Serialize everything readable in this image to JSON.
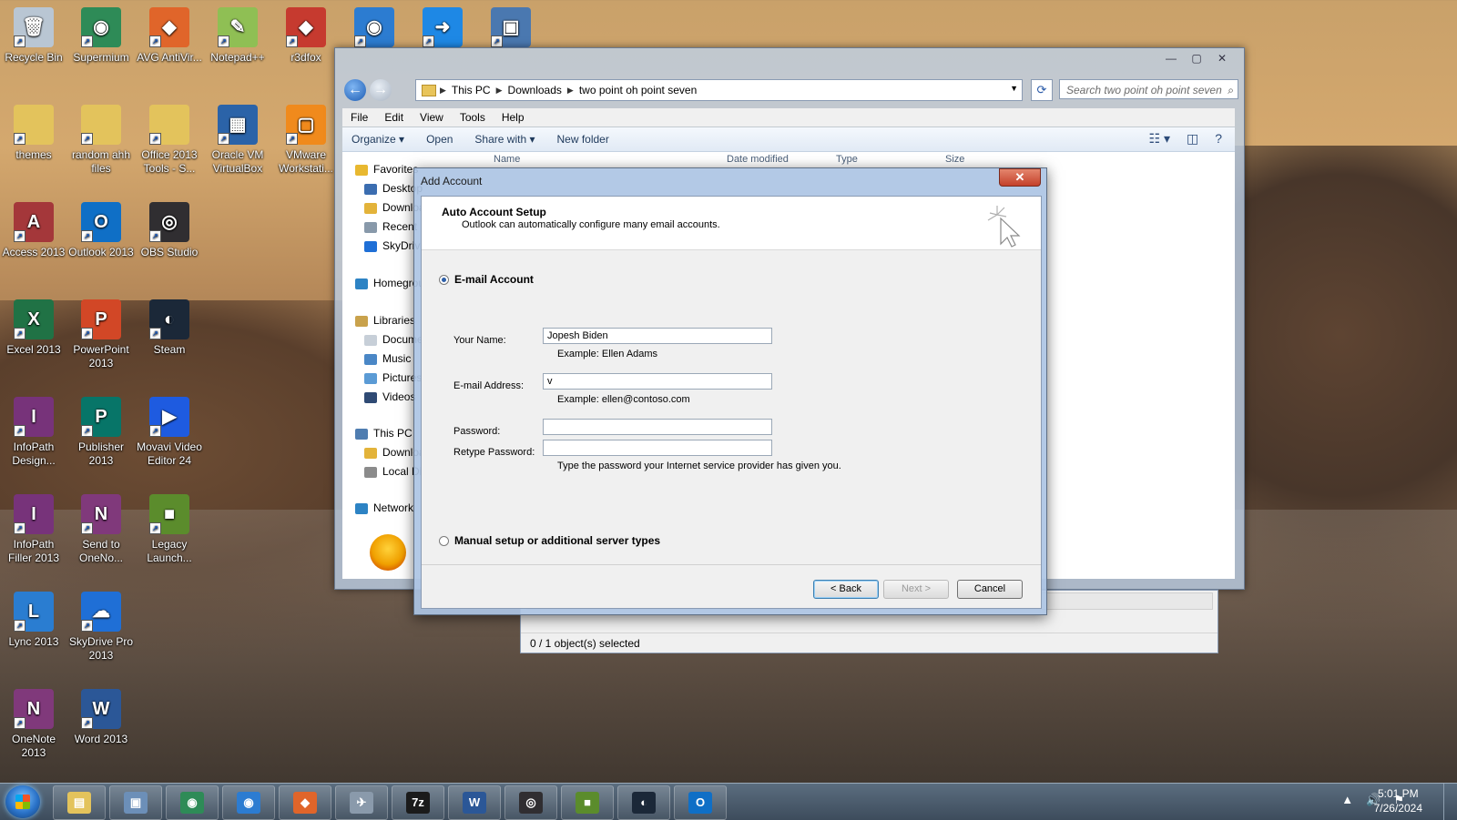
{
  "desktop": {
    "icons": [
      {
        "label": "Recycle Bin",
        "color": "#b9c6d3",
        "glyph": "🗑"
      },
      {
        "label": "Supermium",
        "color": "#2e8b57",
        "glyph": "◉"
      },
      {
        "label": "AVG AntiVir...",
        "color": "#e0652a",
        "glyph": "◆"
      },
      {
        "label": "Notepad++",
        "color": "#8fbf54",
        "glyph": "✎"
      },
      {
        "label": "r3dfox",
        "color": "#c63a2f",
        "glyph": "◆"
      },
      {
        "label": "",
        "color": "#2c7cd1",
        "glyph": "◉"
      },
      {
        "label": "",
        "color": "#1e88e5",
        "glyph": "➜"
      },
      {
        "label": "",
        "color": "#4a78b0",
        "glyph": "▣"
      },
      {
        "label": "themes",
        "color": "#e3c35c",
        "glyph": ""
      },
      {
        "label": "random ahh files",
        "color": "#e3c35c",
        "glyph": ""
      },
      {
        "label": "Office 2013 Tools - S...",
        "color": "#e3c35c",
        "glyph": ""
      },
      {
        "label": "Oracle VM VirtualBox",
        "color": "#2b63a8",
        "glyph": "▦"
      },
      {
        "label": "VMware Workstati...",
        "color": "#f08a1c",
        "glyph": "▢"
      },
      {
        "label": "Access 2013",
        "color": "#a4373a",
        "glyph": "A"
      },
      {
        "label": "Outlook 2013",
        "color": "#0f6fc6",
        "glyph": "O"
      },
      {
        "label": "OBS Studio",
        "color": "#302e31",
        "glyph": "◎"
      },
      {
        "label": "Excel 2013",
        "color": "#207245",
        "glyph": "X"
      },
      {
        "label": "PowerPoint 2013",
        "color": "#d24726",
        "glyph": "P"
      },
      {
        "label": "Steam",
        "color": "#1b2838",
        "glyph": "◐"
      },
      {
        "label": "InfoPath Design...",
        "color": "#77337a",
        "glyph": "I"
      },
      {
        "label": "Publisher 2013",
        "color": "#077568",
        "glyph": "P"
      },
      {
        "label": "Movavi Video Editor 24",
        "color": "#1e5be0",
        "glyph": "▶"
      },
      {
        "label": "InfoPath Filler 2013",
        "color": "#77337a",
        "glyph": "I"
      },
      {
        "label": "Send to OneNo...",
        "color": "#80397b",
        "glyph": "N"
      },
      {
        "label": "Legacy Launch...",
        "color": "#5b8c2c",
        "glyph": "■"
      },
      {
        "label": "Lync 2013",
        "color": "#2a7dd1",
        "glyph": "L"
      },
      {
        "label": "SkyDrive Pro 2013",
        "color": "#1f6fd6",
        "glyph": "☁"
      },
      {
        "label": "OneNote 2013",
        "color": "#80397b",
        "glyph": "N"
      },
      {
        "label": "Word 2013",
        "color": "#2b5797",
        "glyph": "W"
      }
    ]
  },
  "explorer": {
    "breadcrumb": [
      "This PC",
      "Downloads",
      "two point oh point seven"
    ],
    "search_placeholder": "Search two point oh point seven",
    "menu": [
      "File",
      "Edit",
      "View",
      "Tools",
      "Help"
    ],
    "toolbar": {
      "organize": "Organize",
      "open": "Open",
      "share_with": "Share with",
      "new_folder": "New folder"
    },
    "columns": [
      "Name",
      "Date modified",
      "Type",
      "Size"
    ],
    "nav": [
      {
        "label": "Favorites",
        "color": "#e8b830"
      },
      {
        "label": "Desktop",
        "color": "#3b6db0"
      },
      {
        "label": "Downloads",
        "color": "#e3b33a"
      },
      {
        "label": "Recent places",
        "color": "#8899aa"
      },
      {
        "label": "SkyDrive",
        "color": "#1f6fd6"
      },
      {
        "label": "Homegroup",
        "color": "#2d83c4"
      },
      {
        "label": "Libraries",
        "color": "#c9a24c"
      },
      {
        "label": "Documents",
        "color": "#c7cfd8"
      },
      {
        "label": "Music",
        "color": "#4a87c6"
      },
      {
        "label": "Pictures",
        "color": "#5b9bd5"
      },
      {
        "label": "Videos",
        "color": "#2f4a74"
      },
      {
        "label": "This PC",
        "color": "#4f7db0"
      },
      {
        "label": "Downloads",
        "color": "#e3b33a"
      },
      {
        "label": "Local Disk",
        "color": "#8b8b8b"
      },
      {
        "label": "Network",
        "color": "#2d83c4"
      }
    ],
    "status": "0 / 1 object(s) selected"
  },
  "dialog": {
    "title": "Add Account",
    "header_title": "Auto Account Setup",
    "header_sub": "Outlook can automatically configure many email accounts.",
    "email_account_label": "E-mail Account",
    "name_label": "Your Name:",
    "name_value": "Jopesh Biden",
    "name_example": "Example: Ellen Adams",
    "email_label": "E-mail Address:",
    "email_value": "v",
    "email_example": "Example: ellen@contoso.com",
    "password_label": "Password:",
    "retype_label": "Retype Password:",
    "password_hint": "Type the password your Internet service provider has given you.",
    "manual_label": "Manual setup or additional server types",
    "back": "< Back",
    "next": "Next >",
    "cancel": "Cancel"
  },
  "taskbar": {
    "pinned": [
      {
        "name": "explorer",
        "color": "#e3c35c",
        "glyph": "▤"
      },
      {
        "name": "computer",
        "color": "#6c8fb8",
        "glyph": "▣"
      },
      {
        "name": "supermium",
        "color": "#2e8b57",
        "glyph": "◉"
      },
      {
        "name": "browser",
        "color": "#2c7cd1",
        "glyph": "◉"
      },
      {
        "name": "office-tools",
        "color": "#e0652a",
        "glyph": "◆"
      },
      {
        "name": "app",
        "color": "#8a9aab",
        "glyph": "✈"
      },
      {
        "name": "7zip",
        "color": "#1b1b1b",
        "glyph": "7z"
      },
      {
        "name": "word",
        "color": "#2b5797",
        "glyph": "W"
      },
      {
        "name": "obs",
        "color": "#302e31",
        "glyph": "◎"
      },
      {
        "name": "minecraft",
        "color": "#5b8c2c",
        "glyph": "■"
      },
      {
        "name": "steam",
        "color": "#1b2838",
        "glyph": "◐"
      },
      {
        "name": "outlook",
        "color": "#0f6fc6",
        "glyph": "O"
      }
    ],
    "time": "5:01 PM",
    "date": "7/26/2024"
  }
}
